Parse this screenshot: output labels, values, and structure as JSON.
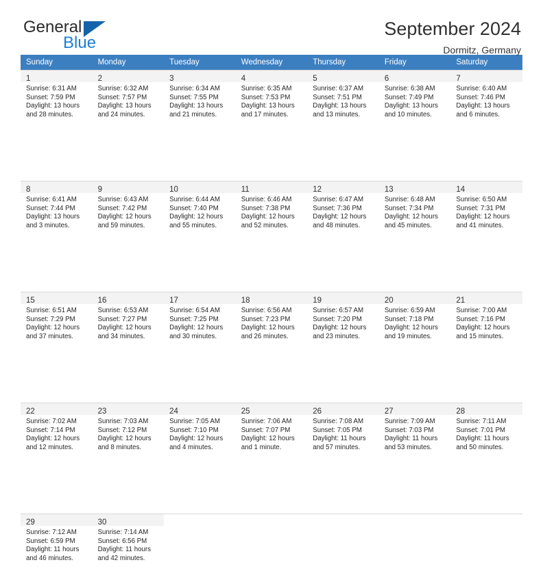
{
  "brand": {
    "word_one": "General",
    "word_two": "Blue",
    "icon": "triangle-logo",
    "accent_color": "#1464aa",
    "blue_text_color": "#1a7fd4"
  },
  "header": {
    "title": "September 2024",
    "subtitle": "Dormitz, Germany"
  },
  "theme": {
    "header_row_bg": "#3c7fc1",
    "header_row_text": "#ffffff",
    "daynum_band_bg": "#f3f3f3",
    "cell_border": "#d8d8d8"
  },
  "weekday_headers": [
    "Sunday",
    "Monday",
    "Tuesday",
    "Wednesday",
    "Thursday",
    "Friday",
    "Saturday"
  ],
  "weeks": [
    [
      {
        "day": "1",
        "sunrise": "Sunrise: 6:31 AM",
        "sunset": "Sunset: 7:59 PM",
        "daylight_1": "Daylight: 13 hours",
        "daylight_2": "and 28 minutes."
      },
      {
        "day": "2",
        "sunrise": "Sunrise: 6:32 AM",
        "sunset": "Sunset: 7:57 PM",
        "daylight_1": "Daylight: 13 hours",
        "daylight_2": "and 24 minutes."
      },
      {
        "day": "3",
        "sunrise": "Sunrise: 6:34 AM",
        "sunset": "Sunset: 7:55 PM",
        "daylight_1": "Daylight: 13 hours",
        "daylight_2": "and 21 minutes."
      },
      {
        "day": "4",
        "sunrise": "Sunrise: 6:35 AM",
        "sunset": "Sunset: 7:53 PM",
        "daylight_1": "Daylight: 13 hours",
        "daylight_2": "and 17 minutes."
      },
      {
        "day": "5",
        "sunrise": "Sunrise: 6:37 AM",
        "sunset": "Sunset: 7:51 PM",
        "daylight_1": "Daylight: 13 hours",
        "daylight_2": "and 13 minutes."
      },
      {
        "day": "6",
        "sunrise": "Sunrise: 6:38 AM",
        "sunset": "Sunset: 7:49 PM",
        "daylight_1": "Daylight: 13 hours",
        "daylight_2": "and 10 minutes."
      },
      {
        "day": "7",
        "sunrise": "Sunrise: 6:40 AM",
        "sunset": "Sunset: 7:46 PM",
        "daylight_1": "Daylight: 13 hours",
        "daylight_2": "and 6 minutes."
      }
    ],
    [
      {
        "day": "8",
        "sunrise": "Sunrise: 6:41 AM",
        "sunset": "Sunset: 7:44 PM",
        "daylight_1": "Daylight: 13 hours",
        "daylight_2": "and 3 minutes."
      },
      {
        "day": "9",
        "sunrise": "Sunrise: 6:43 AM",
        "sunset": "Sunset: 7:42 PM",
        "daylight_1": "Daylight: 12 hours",
        "daylight_2": "and 59 minutes."
      },
      {
        "day": "10",
        "sunrise": "Sunrise: 6:44 AM",
        "sunset": "Sunset: 7:40 PM",
        "daylight_1": "Daylight: 12 hours",
        "daylight_2": "and 55 minutes."
      },
      {
        "day": "11",
        "sunrise": "Sunrise: 6:46 AM",
        "sunset": "Sunset: 7:38 PM",
        "daylight_1": "Daylight: 12 hours",
        "daylight_2": "and 52 minutes."
      },
      {
        "day": "12",
        "sunrise": "Sunrise: 6:47 AM",
        "sunset": "Sunset: 7:36 PM",
        "daylight_1": "Daylight: 12 hours",
        "daylight_2": "and 48 minutes."
      },
      {
        "day": "13",
        "sunrise": "Sunrise: 6:48 AM",
        "sunset": "Sunset: 7:34 PM",
        "daylight_1": "Daylight: 12 hours",
        "daylight_2": "and 45 minutes."
      },
      {
        "day": "14",
        "sunrise": "Sunrise: 6:50 AM",
        "sunset": "Sunset: 7:31 PM",
        "daylight_1": "Daylight: 12 hours",
        "daylight_2": "and 41 minutes."
      }
    ],
    [
      {
        "day": "15",
        "sunrise": "Sunrise: 6:51 AM",
        "sunset": "Sunset: 7:29 PM",
        "daylight_1": "Daylight: 12 hours",
        "daylight_2": "and 37 minutes."
      },
      {
        "day": "16",
        "sunrise": "Sunrise: 6:53 AM",
        "sunset": "Sunset: 7:27 PM",
        "daylight_1": "Daylight: 12 hours",
        "daylight_2": "and 34 minutes."
      },
      {
        "day": "17",
        "sunrise": "Sunrise: 6:54 AM",
        "sunset": "Sunset: 7:25 PM",
        "daylight_1": "Daylight: 12 hours",
        "daylight_2": "and 30 minutes."
      },
      {
        "day": "18",
        "sunrise": "Sunrise: 6:56 AM",
        "sunset": "Sunset: 7:23 PM",
        "daylight_1": "Daylight: 12 hours",
        "daylight_2": "and 26 minutes."
      },
      {
        "day": "19",
        "sunrise": "Sunrise: 6:57 AM",
        "sunset": "Sunset: 7:20 PM",
        "daylight_1": "Daylight: 12 hours",
        "daylight_2": "and 23 minutes."
      },
      {
        "day": "20",
        "sunrise": "Sunrise: 6:59 AM",
        "sunset": "Sunset: 7:18 PM",
        "daylight_1": "Daylight: 12 hours",
        "daylight_2": "and 19 minutes."
      },
      {
        "day": "21",
        "sunrise": "Sunrise: 7:00 AM",
        "sunset": "Sunset: 7:16 PM",
        "daylight_1": "Daylight: 12 hours",
        "daylight_2": "and 15 minutes."
      }
    ],
    [
      {
        "day": "22",
        "sunrise": "Sunrise: 7:02 AM",
        "sunset": "Sunset: 7:14 PM",
        "daylight_1": "Daylight: 12 hours",
        "daylight_2": "and 12 minutes."
      },
      {
        "day": "23",
        "sunrise": "Sunrise: 7:03 AM",
        "sunset": "Sunset: 7:12 PM",
        "daylight_1": "Daylight: 12 hours",
        "daylight_2": "and 8 minutes."
      },
      {
        "day": "24",
        "sunrise": "Sunrise: 7:05 AM",
        "sunset": "Sunset: 7:10 PM",
        "daylight_1": "Daylight: 12 hours",
        "daylight_2": "and 4 minutes."
      },
      {
        "day": "25",
        "sunrise": "Sunrise: 7:06 AM",
        "sunset": "Sunset: 7:07 PM",
        "daylight_1": "Daylight: 12 hours",
        "daylight_2": "and 1 minute."
      },
      {
        "day": "26",
        "sunrise": "Sunrise: 7:08 AM",
        "sunset": "Sunset: 7:05 PM",
        "daylight_1": "Daylight: 11 hours",
        "daylight_2": "and 57 minutes."
      },
      {
        "day": "27",
        "sunrise": "Sunrise: 7:09 AM",
        "sunset": "Sunset: 7:03 PM",
        "daylight_1": "Daylight: 11 hours",
        "daylight_2": "and 53 minutes."
      },
      {
        "day": "28",
        "sunrise": "Sunrise: 7:11 AM",
        "sunset": "Sunset: 7:01 PM",
        "daylight_1": "Daylight: 11 hours",
        "daylight_2": "and 50 minutes."
      }
    ],
    [
      {
        "day": "29",
        "sunrise": "Sunrise: 7:12 AM",
        "sunset": "Sunset: 6:59 PM",
        "daylight_1": "Daylight: 11 hours",
        "daylight_2": "and 46 minutes."
      },
      {
        "day": "30",
        "sunrise": "Sunrise: 7:14 AM",
        "sunset": "Sunset: 6:56 PM",
        "daylight_1": "Daylight: 11 hours",
        "daylight_2": "and 42 minutes."
      },
      {
        "day": "",
        "sunrise": "",
        "sunset": "",
        "daylight_1": "",
        "daylight_2": ""
      },
      {
        "day": "",
        "sunrise": "",
        "sunset": "",
        "daylight_1": "",
        "daylight_2": ""
      },
      {
        "day": "",
        "sunrise": "",
        "sunset": "",
        "daylight_1": "",
        "daylight_2": ""
      },
      {
        "day": "",
        "sunrise": "",
        "sunset": "",
        "daylight_1": "",
        "daylight_2": ""
      },
      {
        "day": "",
        "sunrise": "",
        "sunset": "",
        "daylight_1": "",
        "daylight_2": ""
      }
    ]
  ]
}
